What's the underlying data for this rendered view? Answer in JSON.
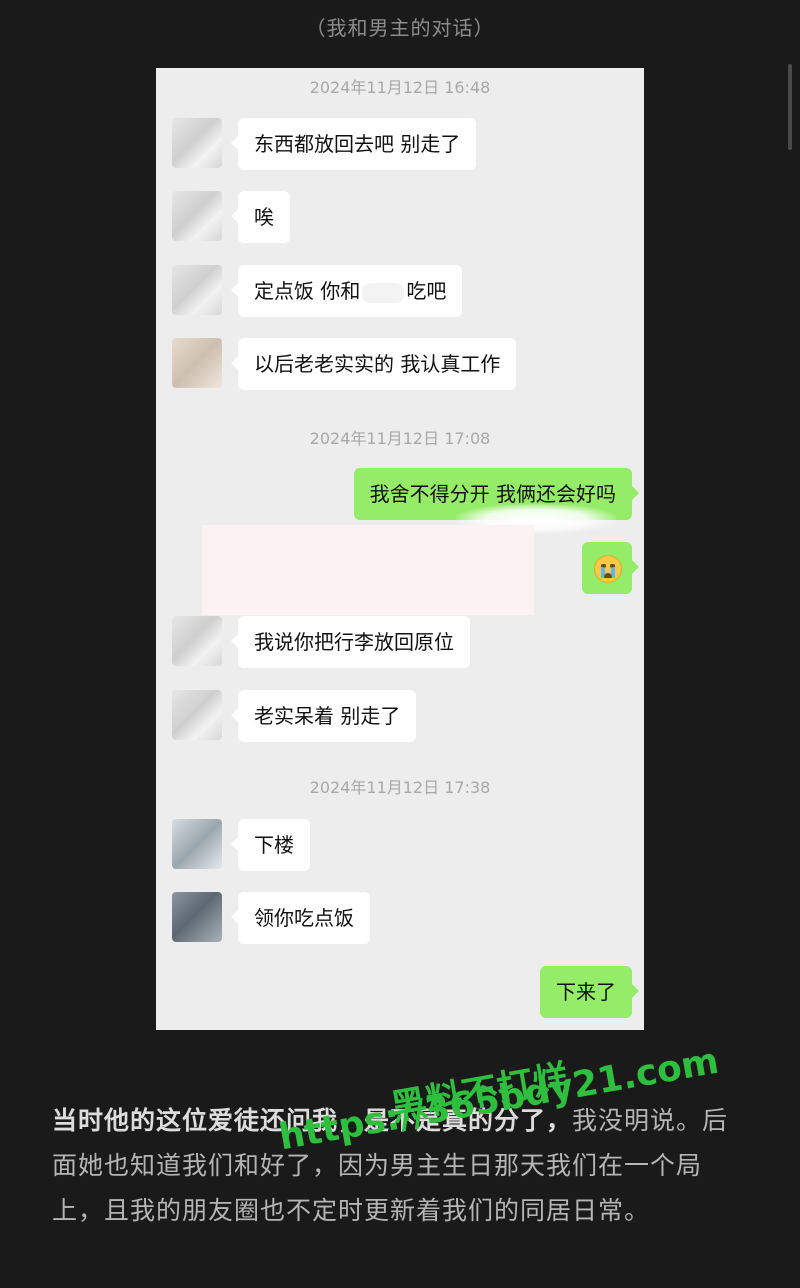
{
  "caption": "（我和男主的对话）",
  "messages": {
    "ts1": "2024年11月12日 16:48",
    "m1": "东西都放回去吧 别走了",
    "m2": "唉",
    "m3_pre": "定点饭 你和",
    "m3_post": "吃吧",
    "m4": "以后老老实实的 我认真工作",
    "ts2": "2024年11月12日 17:08",
    "m5": "我舍不得分开 我俩还会好吗",
    "m6_emoji": "crying-face-emoji",
    "m7": "我说你把行李放回原位",
    "m8": "老实呆着 别走了",
    "ts3": "2024年11月12日 17:38",
    "m9": "下楼",
    "m10": "领你吃点饭",
    "m11": "下来了"
  },
  "body": {
    "bold": "当时他的这位爱徒还问我，是不是真的分了，",
    "rest": "我没明说。后面她也知道我们和好了，因为男主生日那天我们在一个局上，且我的朋友圈也不定时更新着我们的同居日常。"
  },
  "watermark": {
    "line1": "黑料不打烊",
    "line2": "https://365bdy21.com"
  },
  "colors": {
    "background": "#1a1a1a",
    "chat_bg": "#ededed",
    "out_bubble": "#95ec69",
    "in_bubble": "#ffffff",
    "watermark": "#2fbf3e"
  }
}
